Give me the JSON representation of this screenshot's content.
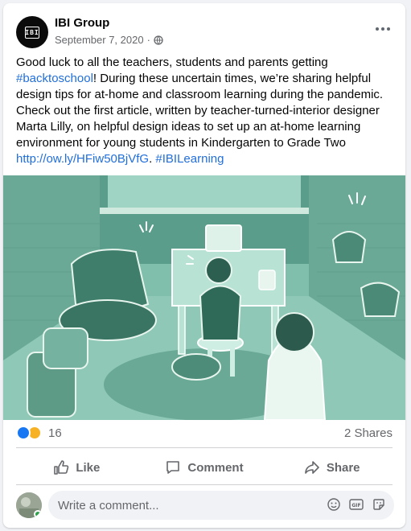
{
  "post": {
    "page_name": "IBI Group",
    "avatar_text": "IBI",
    "date": "September 7, 2020",
    "meta_separator": "·",
    "privacy_icon": "globe-icon",
    "more_icon": "more-horizontal-icon",
    "text_part1": "Good luck to all the teachers, students and parents getting ",
    "hashtag1": "#backtoschool",
    "text_part2": "! During these uncertain times, we’re sharing helpful design tips for at-home and classroom learning during the pandemic. Check out the first article, written by teacher-turned-interior designer Marta Lilly, on helpful design ideas to set up an at-home learning environment for young students in Kindergarten to Grade Two ",
    "link": "http://ow.ly/HFiw50BjVfG",
    "text_part3": ". ",
    "hashtag2": "#IBILearning"
  },
  "image": {
    "tint_color": "#7fbfab"
  },
  "reactions": {
    "types": [
      "like",
      "care"
    ],
    "count": "16",
    "shares": "2 Shares"
  },
  "actions": {
    "like": "Like",
    "comment": "Comment",
    "share": "Share"
  },
  "comment_box": {
    "placeholder": "Write a comment...",
    "tools": [
      "emoji-icon",
      "gif-icon",
      "sticker-icon"
    ]
  },
  "colors": {
    "link": "#216fdb",
    "like_blue": "#1877f2",
    "secondary_text": "#65676b"
  }
}
